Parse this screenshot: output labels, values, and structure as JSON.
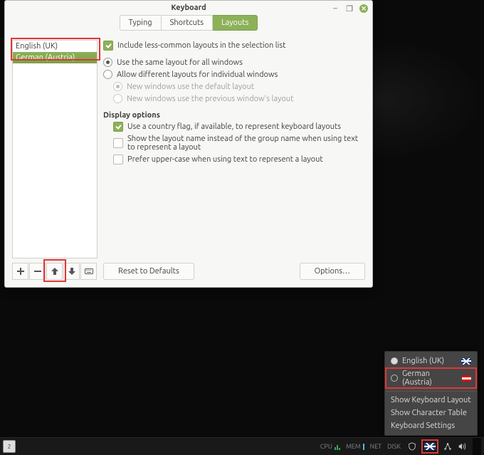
{
  "window": {
    "title": "Keyboard",
    "tabs": [
      "Typing",
      "Shortcuts",
      "Layouts"
    ],
    "active_tab": 2,
    "layout_list": [
      {
        "label": "English (UK)",
        "selected": false
      },
      {
        "label": "German (Austria)",
        "selected": true
      }
    ],
    "checks": {
      "include_less_common": {
        "label": "Include less-common layouts in the selection list",
        "checked": true
      },
      "use_country_flag": {
        "label": "Use a country flag, if available, to represent keyboard layouts",
        "checked": true
      },
      "show_layout_name": {
        "label": "Show the layout name instead of the group name when using text to represent a layout",
        "checked": false
      },
      "prefer_upper": {
        "label": "Prefer upper-case when using text to represent a layout",
        "checked": false
      }
    },
    "radios": {
      "same_layout": {
        "label": "Use the same layout for all windows",
        "selected": true
      },
      "allow_diff": {
        "label": "Allow different layouts for individual windows",
        "selected": false
      },
      "new_default": {
        "label": "New windows use the default layout",
        "selected": true
      },
      "new_previous": {
        "label": "New windows use the previous window's layout",
        "selected": false
      }
    },
    "section_display": "Display options",
    "reset_label": "Reset to Defaults",
    "options_label": "Options…"
  },
  "popup": {
    "items": [
      {
        "label": "English (UK)",
        "flag": "uk",
        "selected": true
      },
      {
        "label": "German (Austria)",
        "flag": "at",
        "selected": false
      }
    ],
    "actions": [
      "Show Keyboard Layout",
      "Show Character Table",
      "Keyboard Settings"
    ]
  },
  "taskbar": {
    "workspace": "2",
    "meters": [
      "CPU",
      "MEM",
      "NET",
      "DISK"
    ]
  }
}
